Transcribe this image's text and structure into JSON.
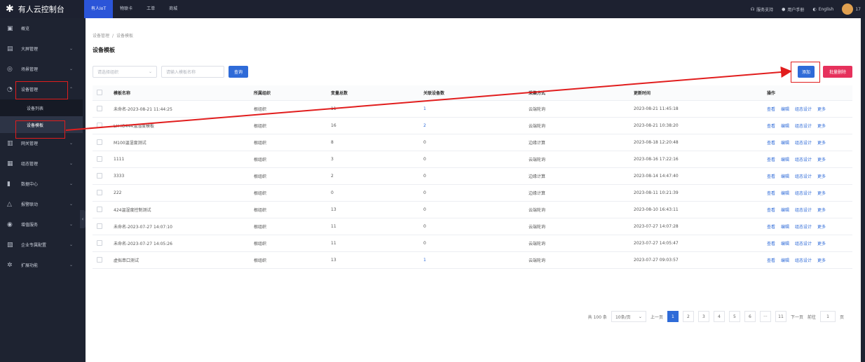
{
  "topbar": {
    "logo": "✱",
    "brand": "有人云控制台",
    "nav": [
      "有人IoT",
      "物联卡",
      "工单",
      "商城"
    ],
    "right": {
      "support": "服务支持",
      "user_manual": "用户手册",
      "language": "English",
      "user": "17"
    }
  },
  "sidebar": {
    "items": [
      {
        "label": "概览",
        "icon": "▣",
        "chev": ""
      },
      {
        "label": "大屏管理",
        "icon": "▤",
        "chev": "⌄"
      },
      {
        "label": "场景管理",
        "icon": "◎",
        "chev": "⌄"
      },
      {
        "label": "设备管理",
        "icon": "◔",
        "chev": "⌃"
      },
      {
        "label": "网关管理",
        "icon": "▥",
        "chev": "⌄"
      },
      {
        "label": "组态管理",
        "icon": "▦",
        "chev": "⌄"
      },
      {
        "label": "数据中心",
        "icon": "▮",
        "chev": "⌄"
      },
      {
        "label": "报警联动",
        "icon": "△",
        "chev": "⌄"
      },
      {
        "label": "增值服务",
        "icon": "◉",
        "chev": "⌄"
      },
      {
        "label": "企业专属配置",
        "icon": "▧",
        "chev": "⌄"
      },
      {
        "label": "扩展功能",
        "icon": "✲",
        "chev": "⌄"
      }
    ],
    "submenu": [
      "设备列表",
      "设备模板"
    ],
    "collapse": "‹"
  },
  "page": {
    "breadcrumb": [
      "设备管理",
      "设备模板"
    ],
    "title": "设备模板",
    "filters": {
      "org_placeholder": "请选择组织",
      "name_placeholder": "请输入模板名称",
      "search_label": "查询"
    },
    "actions": {
      "add_label": "添加",
      "batch_delete_label": "批量删除"
    }
  },
  "table": {
    "headers": [
      "模板名称",
      "所属组织",
      "变量总数",
      "关联设备数",
      "采集方式",
      "更新时间",
      "操作"
    ],
    "ops": [
      "查看",
      "编辑",
      "组态设计",
      "更多"
    ],
    "rows": [
      {
        "name": "未命名-2023-08-21 11:44:25",
        "org": "根组织",
        "total": "11",
        "rel": "1",
        "mode": "云端轮询",
        "time": "2023-08-21 11:45:18"
      },
      {
        "name": "LH-IO444温湿度模板",
        "org": "根组织",
        "total": "16",
        "rel": "2",
        "mode": "云端轮询",
        "time": "2023-08-21 10:38:20"
      },
      {
        "name": "M100温湿度测试",
        "org": "根组织",
        "total": "8",
        "rel": "0",
        "mode": "边缘计算",
        "time": "2023-08-18 12:20:48"
      },
      {
        "name": "1111",
        "org": "根组织",
        "total": "3",
        "rel": "0",
        "mode": "云端轮询",
        "time": "2023-08-16 17:22:16"
      },
      {
        "name": "3333",
        "org": "根组织",
        "total": "2",
        "rel": "0",
        "mode": "边缘计算",
        "time": "2023-08-14 14:47:40"
      },
      {
        "name": "222",
        "org": "根组织",
        "total": "0",
        "rel": "0",
        "mode": "边缘计算",
        "time": "2023-08-11 10:21:39"
      },
      {
        "name": "424温湿度控制测试",
        "org": "根组织",
        "total": "13",
        "rel": "0",
        "mode": "云端轮询",
        "time": "2023-08-10 16:43:11"
      },
      {
        "name": "未命名-2023-07-27 14:07:10",
        "org": "根组织",
        "total": "11",
        "rel": "0",
        "mode": "云端轮询",
        "time": "2023-07-27 14:07:28"
      },
      {
        "name": "未命名-2023-07-27 14:05:26",
        "org": "根组织",
        "total": "11",
        "rel": "0",
        "mode": "云端轮询",
        "time": "2023-07-27 14:05:47"
      },
      {
        "name": "虚拟串口测试",
        "org": "根组织",
        "total": "13",
        "rel": "1",
        "mode": "云端轮询",
        "time": "2023-07-27 09:03:57"
      }
    ]
  },
  "pagination": {
    "total": "共 100 条",
    "page_size": "10条/页",
    "prev": "上一页",
    "pages": [
      "1",
      "2",
      "3",
      "4",
      "5",
      "6",
      "···",
      "11"
    ],
    "next": "下一页",
    "goto": "前往",
    "goto_value": "1",
    "page_unit": "页"
  },
  "colors": {
    "accent": "#2f6bd8",
    "danger": "#e6315c",
    "annotation": "#e11d1d",
    "sidebar_bg": "#1e2331"
  }
}
